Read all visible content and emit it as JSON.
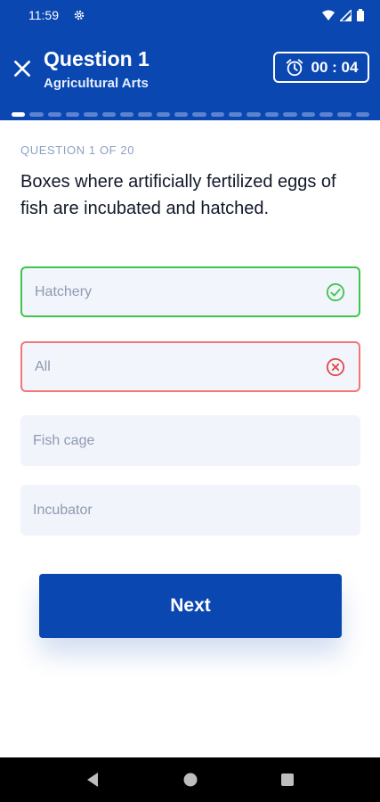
{
  "status_bar": {
    "time": "11:59"
  },
  "header": {
    "title": "Question 1",
    "subtitle": "Agricultural Arts",
    "timer": "00 : 04",
    "progress_total_segments": 20,
    "progress_current": 1
  },
  "quiz": {
    "counter": "QUESTION 1 OF 20",
    "question": "Boxes where artificially fertilized eggs of fish are incubated and hatched.",
    "options": [
      {
        "label": "Hatchery",
        "state": "correct"
      },
      {
        "label": "All",
        "state": "wrong"
      },
      {
        "label": "Fish cage",
        "state": "neutral"
      },
      {
        "label": "Incubator",
        "state": "neutral"
      }
    ]
  },
  "actions": {
    "next_label": "Next"
  },
  "colors": {
    "primary": "#0a47b0",
    "correct": "#3fc54c",
    "wrong": "#f27676"
  }
}
